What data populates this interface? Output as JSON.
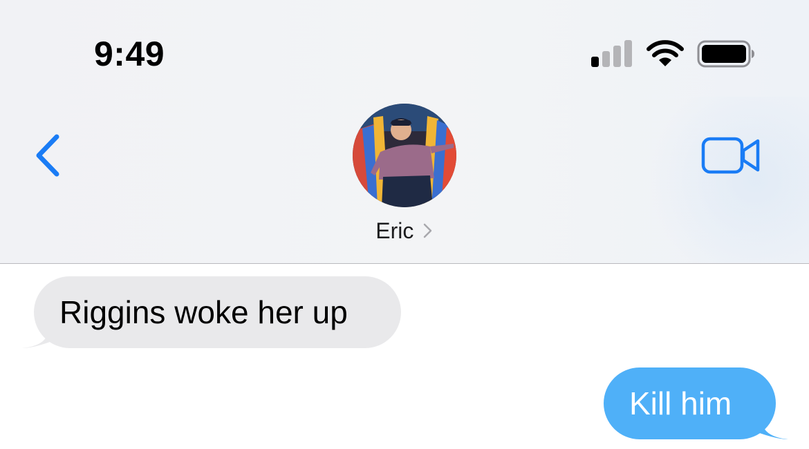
{
  "status_bar": {
    "time": "9:49",
    "signal_icon": "cellular-signal-icon",
    "signal_bars_active": 1,
    "signal_bars_total": 4,
    "wifi_icon": "wifi-icon",
    "battery_icon": "battery-icon",
    "battery_level": 1.0
  },
  "nav": {
    "back_icon": "chevron-left-icon",
    "video_icon": "facetime-video-icon",
    "contact": {
      "name": "Eric",
      "chevron_icon": "chevron-right-icon",
      "avatar_icon": "contact-photo"
    }
  },
  "messages": [
    {
      "direction": "incoming",
      "text": "Riggins woke her up"
    },
    {
      "direction": "outgoing",
      "text": "Kill him"
    }
  ],
  "colors": {
    "accent": "#1a7cf5",
    "outgoing_bubble": "#4fb0f8",
    "incoming_bubble": "#e9e9eb",
    "header_bg": "#f2f3f5"
  }
}
